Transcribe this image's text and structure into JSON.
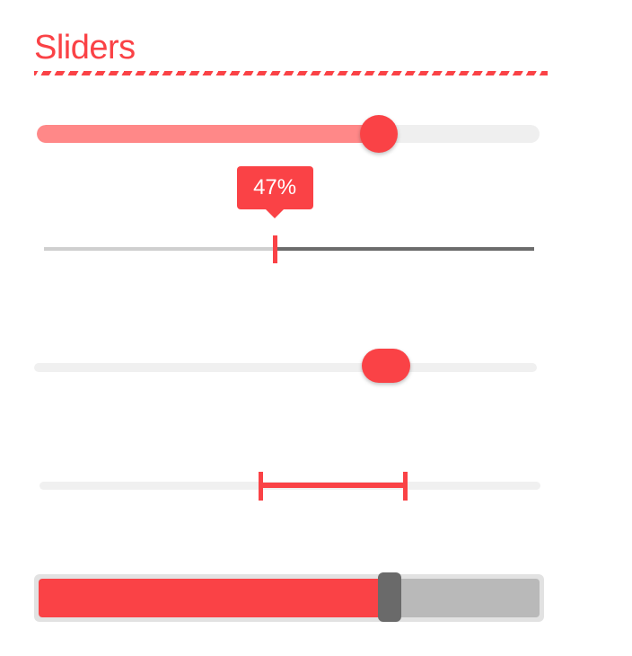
{
  "header": {
    "title": "Sliders"
  },
  "colors": {
    "accent": "#fa4246",
    "fill_light": "#ff8888",
    "track": "#efefef",
    "track_dark": "#6c6c6c",
    "thumb_gray": "#6a6a6a",
    "track_gray": "#b9b9b9"
  },
  "sliders": [
    {
      "id": "slider-1",
      "value_percent": 68
    },
    {
      "id": "slider-2",
      "value_percent": 47,
      "tooltip": "47%"
    },
    {
      "id": "slider-3",
      "value_percent": 70
    },
    {
      "id": "slider-4",
      "range_percent": [
        44,
        73
      ]
    },
    {
      "id": "slider-5",
      "value_percent": 70
    }
  ]
}
